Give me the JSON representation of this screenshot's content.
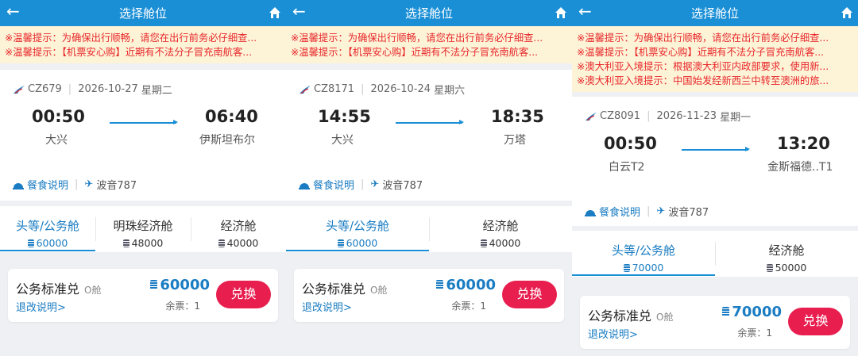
{
  "colors": {
    "primary": "#1a8fd6",
    "accent_red": "#e81e4f",
    "notice_text": "#e8262a",
    "notice_bg": "#fdf4d8"
  },
  "panels": [
    {
      "header": {
        "title": "选择舱位",
        "back_icon": "arrow-left-icon",
        "home_icon": "home-icon"
      },
      "notices": [
        "※温馨提示：为确保出行顺畅，请您在出行前务必仔细查...",
        "※温馨提示：【机票安心购】近期有不法分子冒充南航客..."
      ],
      "flight": {
        "number": "CZ679",
        "date": "2026-10-27",
        "weekday": "星期二",
        "dep_time": "00:50",
        "dep_city": "大兴",
        "arr_time": "06:40",
        "arr_city": "伊斯坦布尔",
        "meal_label": "餐食说明",
        "aircraft": "波音787"
      },
      "tabs": [
        {
          "name": "头等/公务舱",
          "points": "60000",
          "active": true
        },
        {
          "name": "明珠经济舱",
          "points": "48000",
          "active": false
        },
        {
          "name": "经济舱",
          "points": "40000",
          "active": false
        }
      ],
      "card": {
        "name": "公务标准兑",
        "cabin": "O舱",
        "refund": "退改说明>",
        "price": "60000",
        "remaining": "余票：1",
        "button": "兑换"
      }
    },
    {
      "header": {
        "title": "选择舱位",
        "back_icon": "arrow-left-icon",
        "home_icon": "home-icon"
      },
      "notices": [
        "※温馨提示：为确保出行顺畅，请您在出行前务必仔细查...",
        "※温馨提示：【机票安心购】近期有不法分子冒充南航客..."
      ],
      "flight": {
        "number": "CZ8171",
        "date": "2026-10-24",
        "weekday": "星期六",
        "dep_time": "14:55",
        "dep_city": "大兴",
        "arr_time": "18:35",
        "arr_city": "万塔",
        "meal_label": "餐食说明",
        "aircraft": "波音787"
      },
      "tabs": [
        {
          "name": "头等/公务舱",
          "points": "60000",
          "active": true
        },
        {
          "name": "经济舱",
          "points": "40000",
          "active": false
        }
      ],
      "card": {
        "name": "公务标准兑",
        "cabin": "O舱",
        "refund": "退改说明>",
        "price": "60000",
        "remaining": "余票：1",
        "button": "兑换"
      }
    },
    {
      "header": {
        "title": "选择舱位",
        "back_icon": "arrow-left-icon",
        "home_icon": "home-icon"
      },
      "notices": [
        "※温馨提示：为确保出行顺畅，请您在出行前务必仔细查...",
        "※温馨提示：【机票安心购】近期有不法分子冒充南航客...",
        "※澳大利亚入境提示：根据澳大利亚内政部要求，使用新...",
        "※澳大利亚入境提示：中国始发经新西兰中转至澳洲的旅..."
      ],
      "flight": {
        "number": "CZ8091",
        "date": "2026-11-23",
        "weekday": "星期一",
        "dep_time": "00:50",
        "dep_city": "白云T2",
        "arr_time": "13:20",
        "arr_city": "金斯福德..T1",
        "meal_label": "餐食说明",
        "aircraft": "波音787"
      },
      "tabs": [
        {
          "name": "头等/公务舱",
          "points": "70000",
          "active": true
        },
        {
          "name": "经济舱",
          "points": "50000",
          "active": false
        }
      ],
      "card": {
        "name": "公务标准兑",
        "cabin": "O舱",
        "refund": "退改说明>",
        "price": "70000",
        "remaining": "余票：1",
        "button": "兑换"
      }
    }
  ]
}
